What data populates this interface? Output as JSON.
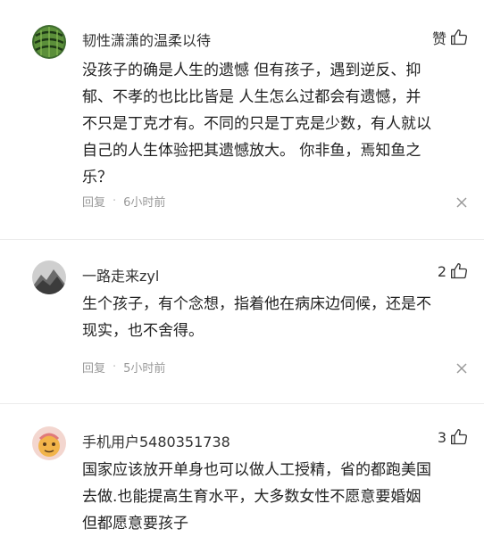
{
  "comments": [
    {
      "username": "韧性潇潇的温柔以待",
      "likes": "赞",
      "text": "没孩子的确是人生的遗憾 但有孩子，遇到逆反、抑\n郁、不孝的也比比皆是 人生怎么过都会有遗憾，并\n不只是丁克才有。不同的只是丁克是少数，有人就以\n自己的人生体验把其遗憾放大。 你非鱼，焉知鱼之\n乐？",
      "reply": "回复",
      "time": "6小时前"
    },
    {
      "username": "一路走来zyl",
      "likes": "2",
      "text": "生个孩子，有个念想，指着他在病床边伺候，还是不\n现实，也不舍得。",
      "reply": "回复",
      "time": "5小时前"
    },
    {
      "username": "手机用户5480351738",
      "likes": "3",
      "text": "国家应该放开单身也可以做人工授精，省的都跑美国\n去做.也能提高生育水平，大多数女性不愿意要婚姻\n但都愿意要孩子",
      "reply": "",
      "time": ""
    }
  ],
  "colors": {
    "text": "#222222",
    "meta": "#999999",
    "divider": "#ececec"
  }
}
